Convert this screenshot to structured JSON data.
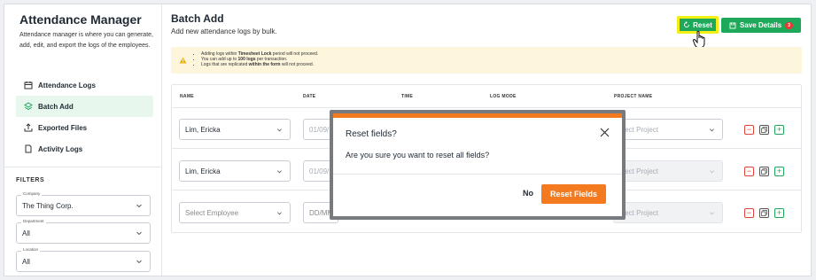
{
  "sidebar": {
    "title": "Attendance Manager",
    "description": "Attendance manager is where you can generate, add, edit, and export the logs of the employees.",
    "nav": [
      {
        "label": "Attendance Logs",
        "icon": "calendar-icon"
      },
      {
        "label": "Batch Add",
        "icon": "stack-icon"
      },
      {
        "label": "Exported Files",
        "icon": "export-icon"
      },
      {
        "label": "Activity Logs",
        "icon": "document-icon"
      }
    ],
    "active_nav": "Batch Add",
    "filters": {
      "title": "FILTERS",
      "company": {
        "label": "Company",
        "value": "The Thing Corp."
      },
      "department": {
        "label": "Department",
        "value": "All"
      },
      "location": {
        "label": "Location",
        "value": "All"
      }
    }
  },
  "header": {
    "title": "Batch Add",
    "subtitle": "Add new attendance logs by bulk.",
    "reset_label": "Reset",
    "save_label": "Save Details",
    "save_badge": "3"
  },
  "warning": {
    "items": [
      {
        "pre": "Adding logs within ",
        "bold": "Timesheet Lock",
        "post": " period will not proceed."
      },
      {
        "pre": "You can add up to ",
        "bold": "100 logs",
        "post": " per transaction."
      },
      {
        "pre": "Logs that are replicated ",
        "bold": "within the form",
        "post": " will not proceed."
      }
    ]
  },
  "table": {
    "headers": [
      "NAME",
      "DATE",
      "TIME",
      "LOG MODE",
      "PROJECT NAME"
    ],
    "rows": [
      {
        "name": "Lim, Ericka",
        "name_placeholder": false,
        "date": "01/09/",
        "date_placeholder": false,
        "project": "elect Project",
        "project_disabled": false
      },
      {
        "name": "Lim, Ericka",
        "name_placeholder": false,
        "date": "01/09/",
        "date_placeholder": false,
        "project": "elect Project",
        "project_disabled": true
      },
      {
        "name": "Select Employee",
        "name_placeholder": true,
        "date": "DD/MM",
        "date_placeholder": true,
        "project": "elect Project",
        "project_disabled": true
      }
    ],
    "actions": {
      "remove": "−",
      "add": "+"
    }
  },
  "modal": {
    "title": "Reset fields?",
    "message": "Are you sure you want to reset all fields?",
    "cancel_label": "No",
    "confirm_label": "Reset Fields"
  },
  "colors": {
    "brand_green": "#1da85a",
    "accent_orange": "#f47a20",
    "highlight_yellow": "#f3ee15",
    "danger_red": "#e53935",
    "warning_bg": "#fdf6dd"
  }
}
